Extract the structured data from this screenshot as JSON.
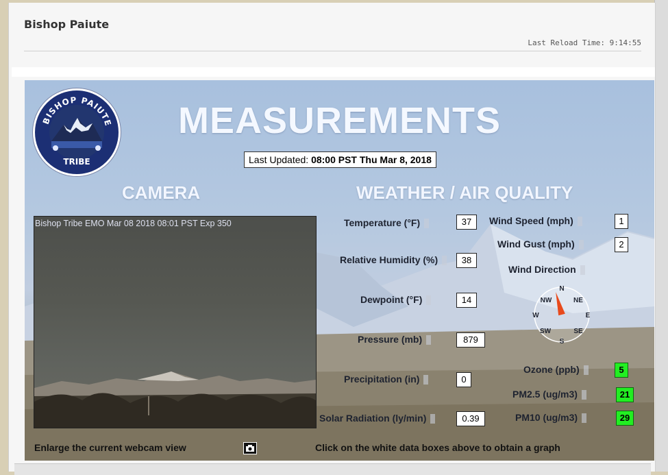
{
  "panel": {
    "title": "Bishop Paiute",
    "reload_label": "Last Reload Time:",
    "reload_time": "9:14:55"
  },
  "dashboard": {
    "logo_icon": "bishop-paiute-tribe-seal",
    "logo_text": "BISHOP PAIUTE TRIBE",
    "title": "MEASUREMENTS",
    "last_updated_label": "Last Updated:",
    "last_updated_value": "08:00 PST Thu Mar 8, 2018",
    "camera_heading": "CAMERA",
    "weather_heading": "WEATHER / AIR QUALITY",
    "camera_caption": "Bishop Tribe EMO Mar 08 2018 08:01 PST  Exp 350",
    "enlarge_label": "Enlarge the current webcam view",
    "enlarge_icon": "camera-icon",
    "graph_hint": "Click on the white data boxes above to obtain a graph"
  },
  "measurements": {
    "temperature": {
      "label": "Temperature (°F)",
      "value": "37"
    },
    "humidity": {
      "label": "Relative Humidity (%)",
      "value": "38"
    },
    "dewpoint": {
      "label": "Dewpoint (°F)",
      "value": "14"
    },
    "pressure": {
      "label": "Pressure (mb)",
      "value": "879"
    },
    "precipitation": {
      "label": "Precipitation (in)",
      "value": "0"
    },
    "solar": {
      "label": "Solar Radiation (ly/min)",
      "value": "0.39"
    },
    "wind_speed": {
      "label": "Wind Speed (mph)",
      "value": "1"
    },
    "wind_gust": {
      "label": "Wind Gust (mph)",
      "value": "2"
    },
    "wind_direction": {
      "label": "Wind Direction"
    },
    "ozone": {
      "label": "Ozone (ppb)",
      "value": "5"
    },
    "pm25": {
      "label": "PM2.5 (ug/m3)",
      "value": "21"
    },
    "pm10": {
      "label": "PM10 (ug/m3)",
      "value": "29"
    }
  },
  "compass": {
    "N": "N",
    "NE": "NE",
    "E": "E",
    "SE": "SE",
    "S": "S",
    "SW": "SW",
    "W": "W",
    "NW": "NW",
    "direction_degrees": 345,
    "needle_color": "#e84a1c"
  },
  "colors": {
    "aq_good": "#22ee22",
    "sky": "#a8c0de",
    "logo_navy": "#1c2f74"
  }
}
